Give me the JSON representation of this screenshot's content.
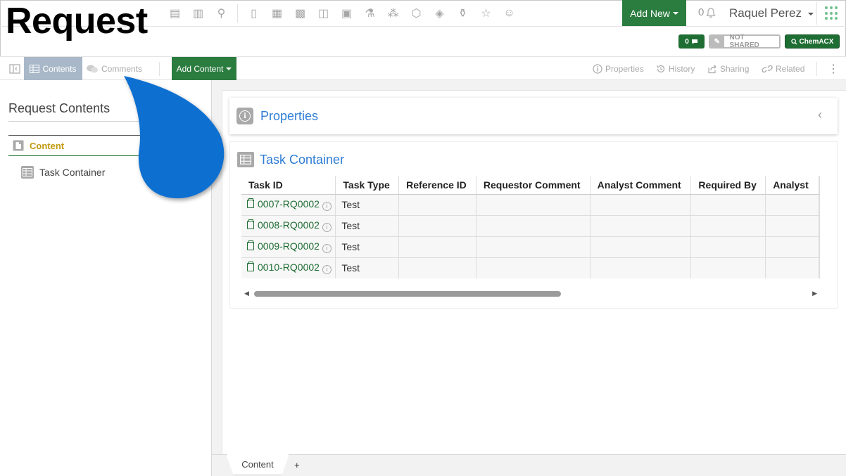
{
  "page_heading": "Request",
  "header": {
    "add_new_label": "Add New",
    "notification_count": "0",
    "user_name": "Raquel Perez",
    "badges": {
      "comments_count": "0",
      "shared_label": "NOT SHARED",
      "chemacx_label": "ChemACX"
    }
  },
  "toolbar": {
    "contents_label": "Contents",
    "comments_label": "Comments",
    "add_content_label": "Add Content",
    "properties_label": "Properties",
    "history_label": "History",
    "sharing_label": "Sharing",
    "related_label": "Related"
  },
  "left_panel": {
    "title": "Request Contents",
    "content_label": "Content",
    "task_container_label": "Task Container"
  },
  "main": {
    "properties_title": "Properties",
    "task_container_title": "Task Container",
    "table": {
      "columns": [
        "Task ID",
        "Task Type",
        "Reference ID",
        "Requestor Comment",
        "Analyst Comment",
        "Required By",
        "Analyst"
      ],
      "rows": [
        {
          "task_id": "0007-RQ0002",
          "task_type": "Test"
        },
        {
          "task_id": "0008-RQ0002",
          "task_type": "Test"
        },
        {
          "task_id": "0009-RQ0002",
          "task_type": "Test"
        },
        {
          "task_id": "0010-RQ0002",
          "task_type": "Test"
        }
      ]
    }
  },
  "bottom_tabs": {
    "active_tab": "Content",
    "add_tab": "+"
  },
  "colors": {
    "brand_green": "#2b7c3f",
    "link_blue": "#2f7dd6",
    "highlight_gold": "#c29a10",
    "pointer_blue": "#0a6fd1"
  }
}
